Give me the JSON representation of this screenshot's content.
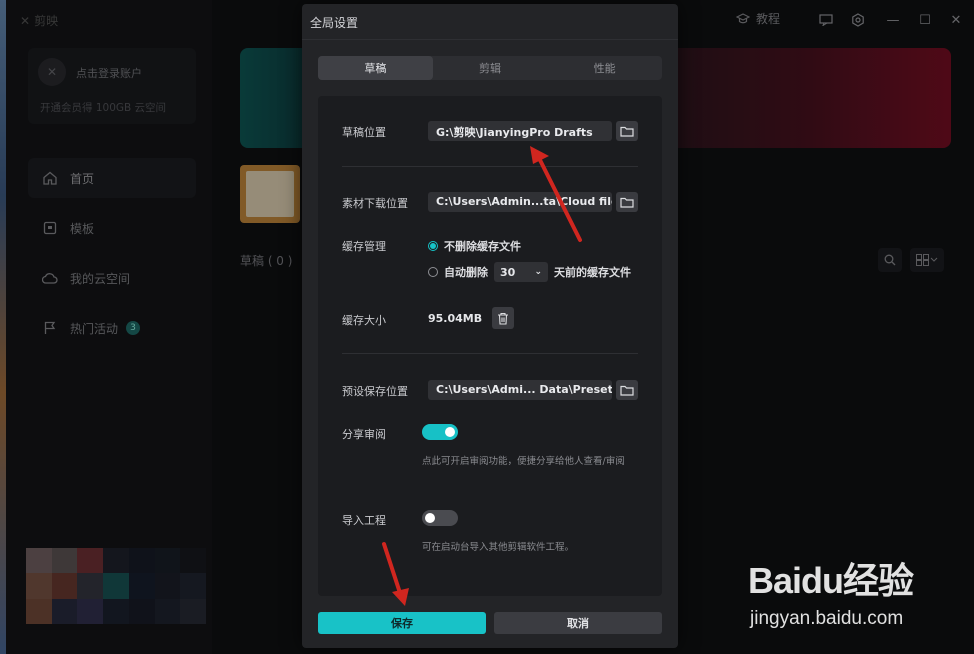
{
  "app": {
    "brand": "剪映"
  },
  "sidebar": {
    "login": "点击登录账户",
    "vip": "开通会员得 100GB 云空间",
    "items": [
      {
        "label": "首页",
        "icon": "home-icon"
      },
      {
        "label": "模板",
        "icon": "template-icon"
      },
      {
        "label": "我的云空间",
        "icon": "cloud-icon"
      },
      {
        "label": "热门活动",
        "icon": "flag-icon",
        "badge": "3"
      }
    ]
  },
  "header": {
    "tutorial": "教程"
  },
  "main": {
    "drafts_label": "草稿 ( 0 )"
  },
  "dialog": {
    "title": "全局设置",
    "tabs": [
      {
        "label": "草稿"
      },
      {
        "label": "剪辑"
      },
      {
        "label": "性能"
      }
    ],
    "draft_location": {
      "label": "草稿位置",
      "value": "G:\\剪映\\JianyingPro Drafts"
    },
    "download_location": {
      "label": "素材下载位置",
      "value": "C:\\Users\\Admin...ta\\Cloud files"
    },
    "cache": {
      "label": "缓存管理",
      "option_keep": "不删除缓存文件",
      "option_auto": "自动删除",
      "days": "30",
      "days_suffix": "天前的缓存文件",
      "selected": "keep"
    },
    "cache_size": {
      "label": "缓存大小",
      "value": "95.04MB"
    },
    "preset_location": {
      "label": "预设保存位置",
      "value": "C:\\Users\\Admi... Data\\Presets"
    },
    "share_review": {
      "label": "分享审阅",
      "enabled": true,
      "hint": "点此可开启审阅功能，便捷分享给他人查看/审阅"
    },
    "import_project": {
      "label": "导入工程",
      "enabled": false,
      "hint": "可在启动台导入其他剪辑软件工程。"
    },
    "save": "保存",
    "cancel": "取消"
  },
  "watermark": {
    "logo": "Baidu经验",
    "url": "jingyan.baidu.com"
  },
  "colors": {
    "accent": "#18c2c7",
    "annotation": "#d0261f"
  }
}
